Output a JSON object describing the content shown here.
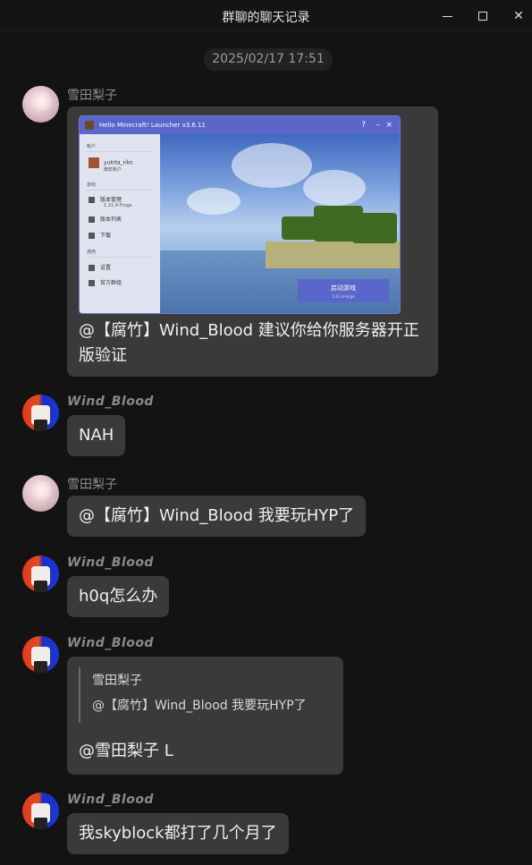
{
  "window": {
    "title": "群聊的聊天记录",
    "minimize_glyph": "—",
    "maximize_glyph": "□",
    "close_glyph": "✕"
  },
  "timestamp": "2025/02/17 17:51",
  "messages": [
    {
      "sender": "雪田梨子",
      "type": "image-text",
      "image": {
        "app_title": "Hello Minecraft! Launcher v3.6.11",
        "sidebar": {
          "account_section": "帐户",
          "account_name": "yukita_riko",
          "account_sub": "微软帐户",
          "game_section": "游戏",
          "version_manage": "版本管理",
          "version_manage_sub": "1.21.4-Forge",
          "version_list": "版本列表",
          "download": "下载",
          "general_section": "通用",
          "settings": "设置",
          "community": "官方群组"
        },
        "launch_button": "启动游戏",
        "launch_sub": "1.21.4-Forge"
      },
      "text": "@【腐竹】Wind_Blood 建议你给你服务器开正版验证"
    },
    {
      "sender": "Wind_Blood",
      "type": "text",
      "text": "NAH"
    },
    {
      "sender": "雪田梨子",
      "type": "text",
      "text": "@【腐竹】Wind_Blood 我要玩HYP了"
    },
    {
      "sender": "Wind_Blood",
      "type": "text",
      "text": "h0q怎么办"
    },
    {
      "sender": "Wind_Blood",
      "type": "reply",
      "quote_sender": "雪田梨子",
      "quote_text": "@【腐竹】Wind_Blood 我要玩HYP了",
      "text": "@雪田梨子 L"
    },
    {
      "sender": "Wind_Blood",
      "type": "text",
      "text": "我skyblock都打了几个月了"
    }
  ],
  "colors": {
    "background": "#131313",
    "bubble": "#3a3a3a",
    "launcher_accent": "#5a66c9"
  }
}
